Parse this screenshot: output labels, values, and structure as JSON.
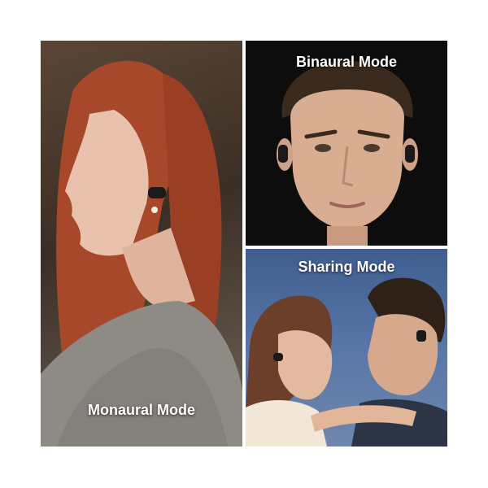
{
  "panels": {
    "left": {
      "caption": "Monaural Mode"
    },
    "top": {
      "caption": "Binaural Mode"
    },
    "bottom": {
      "caption": "Sharing Mode"
    }
  },
  "colors": {
    "background": "#ffffff",
    "hair_red": "#b5532a",
    "sweater_gray": "#8e8a86",
    "earbud_black": "#1a1a1a",
    "sky_blue": "#4f6e9f"
  }
}
